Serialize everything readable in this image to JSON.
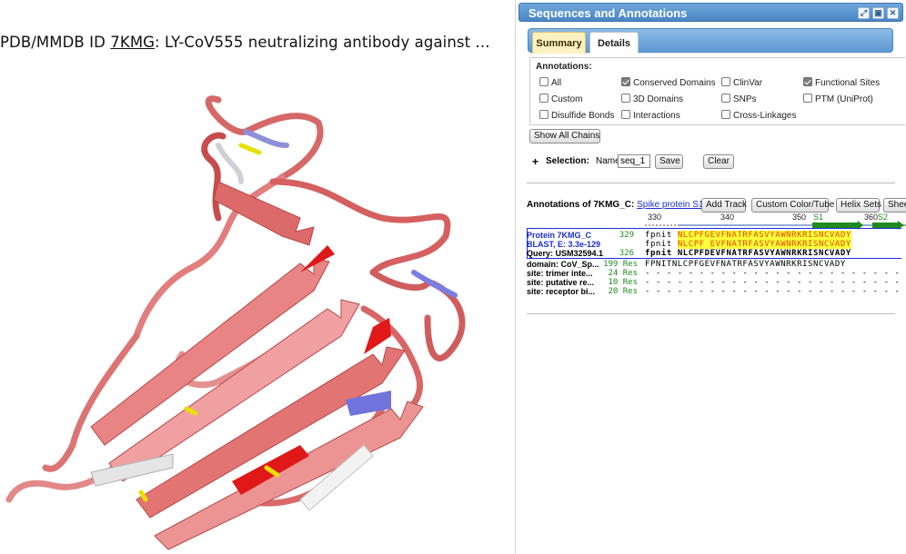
{
  "page": {
    "title_prefix": "PDB/MMDB ID ",
    "pdb_id": "7KMG",
    "title_suffix": ": LY-CoV555 neutralizing antibody against ..."
  },
  "panel": {
    "title": "Sequences and Annotations",
    "tabs": [
      {
        "label": "Summary"
      },
      {
        "label": "Details"
      }
    ],
    "annotations": {
      "heading": "Annotations:",
      "options": [
        {
          "label": "All",
          "checked": false
        },
        {
          "label": "Conserved Domains",
          "checked": true
        },
        {
          "label": "ClinVar",
          "checked": false
        },
        {
          "label": "Functional Sites",
          "checked": true
        },
        {
          "label": "Custom",
          "checked": false
        },
        {
          "label": "3D Domains",
          "checked": false
        },
        {
          "label": "SNPs",
          "checked": false
        },
        {
          "label": "PTM (UniProt)",
          "checked": false
        },
        {
          "label": "Disulfide Bonds",
          "checked": false
        },
        {
          "label": "Interactions",
          "checked": false
        },
        {
          "label": "Cross-Linkages",
          "checked": false
        }
      ]
    },
    "show_all_chains": "Show All Chains",
    "selection": {
      "plus": "+",
      "label": "Selection:",
      "name_label": "Name:",
      "name_value": "seq_1",
      "save": "Save",
      "clear": "Clear"
    },
    "annotations_of": {
      "prefix": "Annotations of 7KMG_C:",
      "link": "Spike protein S1",
      "buttons": [
        "Add Track",
        "Custom Color/Tube",
        "Helix Sets",
        "Sheet"
      ]
    },
    "ruler": {
      "ticks": [
        "330",
        "340",
        "350",
        "360"
      ],
      "features": [
        "S1",
        "S2"
      ]
    },
    "rows": [
      {
        "label": "Protein 7KMG_C",
        "num": "329",
        "pre": "fpnit",
        "seq": "NLCPFGEVFNATRFASVYAWNRKRISNCVADY"
      },
      {
        "label": "BLAST, E: 3.3e-129",
        "num": "",
        "pre": "fpnit",
        "seq": "NLCPF EVFNATRFASVYAWNRKRISNCVADY"
      },
      {
        "label": "Query: USM32594.1",
        "num": "326",
        "pre": "fpnit",
        "seq": "NLCPFDEVFNATRFASVYAWNRKRISNCVADY"
      },
      {
        "label": "domain: CoV_Sp...",
        "num": "199 Res",
        "pre": "FPNIT",
        "seq": "NLCPFGEVFNATRFASVYAWNRKRISNCVADY"
      },
      {
        "label": "site: trimer inte...",
        "num": "24 Res",
        "pre": "- - - - -",
        "seq": "- - - - - - - - - - - - - - - - - - - - - - R - - - - - - - - -"
      },
      {
        "label": "site: putative re...",
        "num": "10 Res",
        "pre": "- - - - -",
        "seq": "- - - - - - - - - - - - - - - - - - - - - - - - - - - - - - - - -"
      },
      {
        "label": "site: receptor bi...",
        "num": "20 Res",
        "pre": "- - - - -",
        "seq": "- - - - - - - - - - - - - - - - - - - - - - - - - - - - - - - - -"
      }
    ]
  },
  "colors": {
    "accent": "#4a86c4",
    "ribbon": "#e07a7a",
    "ribbon_dark": "#c83a3a",
    "ribbon_red": "#e01818",
    "disulfide": "#e8e000",
    "sheet_blue": "#6f73d8",
    "seq_highlight": "#ffff3a",
    "strand_arrow": "#1f8a1f"
  }
}
